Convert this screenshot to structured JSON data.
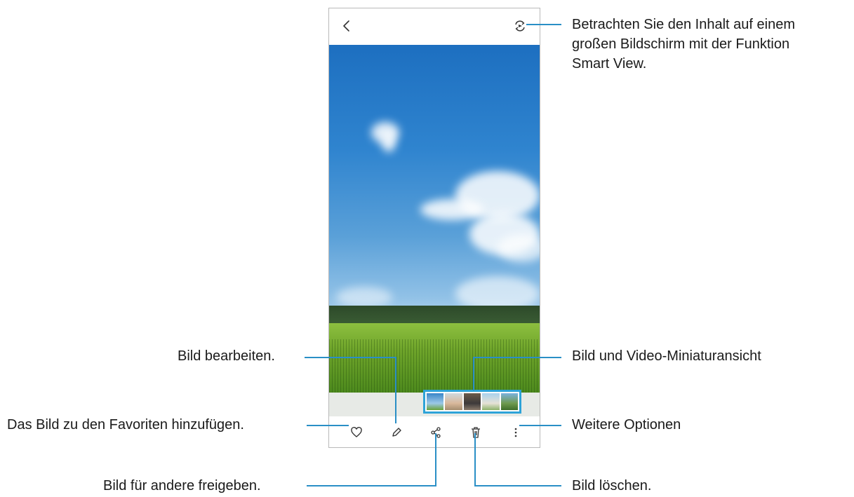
{
  "phone": {
    "icons": {
      "back": "chevron-left-icon",
      "smart_view": "smart-view-icon",
      "favorite": "heart-icon",
      "edit": "pencil-icon",
      "share": "share-icon",
      "delete": "trash-icon",
      "more": "more-vertical-icon"
    }
  },
  "callouts": {
    "smart_view_1": "Betrachten Sie den Inhalt auf einem",
    "smart_view_2": "großen Bildschirm mit der Funktion",
    "smart_view_3": "Smart View.",
    "edit": "Bild bearbeiten.",
    "thumbnails": "Bild und Video-Miniaturansicht",
    "favorites": "Das Bild zu den Favoriten hinzufügen.",
    "more_options": "Weitere Optionen",
    "share": "Bild für andere freigeben.",
    "delete": "Bild löschen."
  },
  "colors": {
    "callout_line": "#2a8fc6",
    "thumb_highlight": "#2ea3d8",
    "sky": "#2f84cf",
    "field": "#6ea42a"
  }
}
